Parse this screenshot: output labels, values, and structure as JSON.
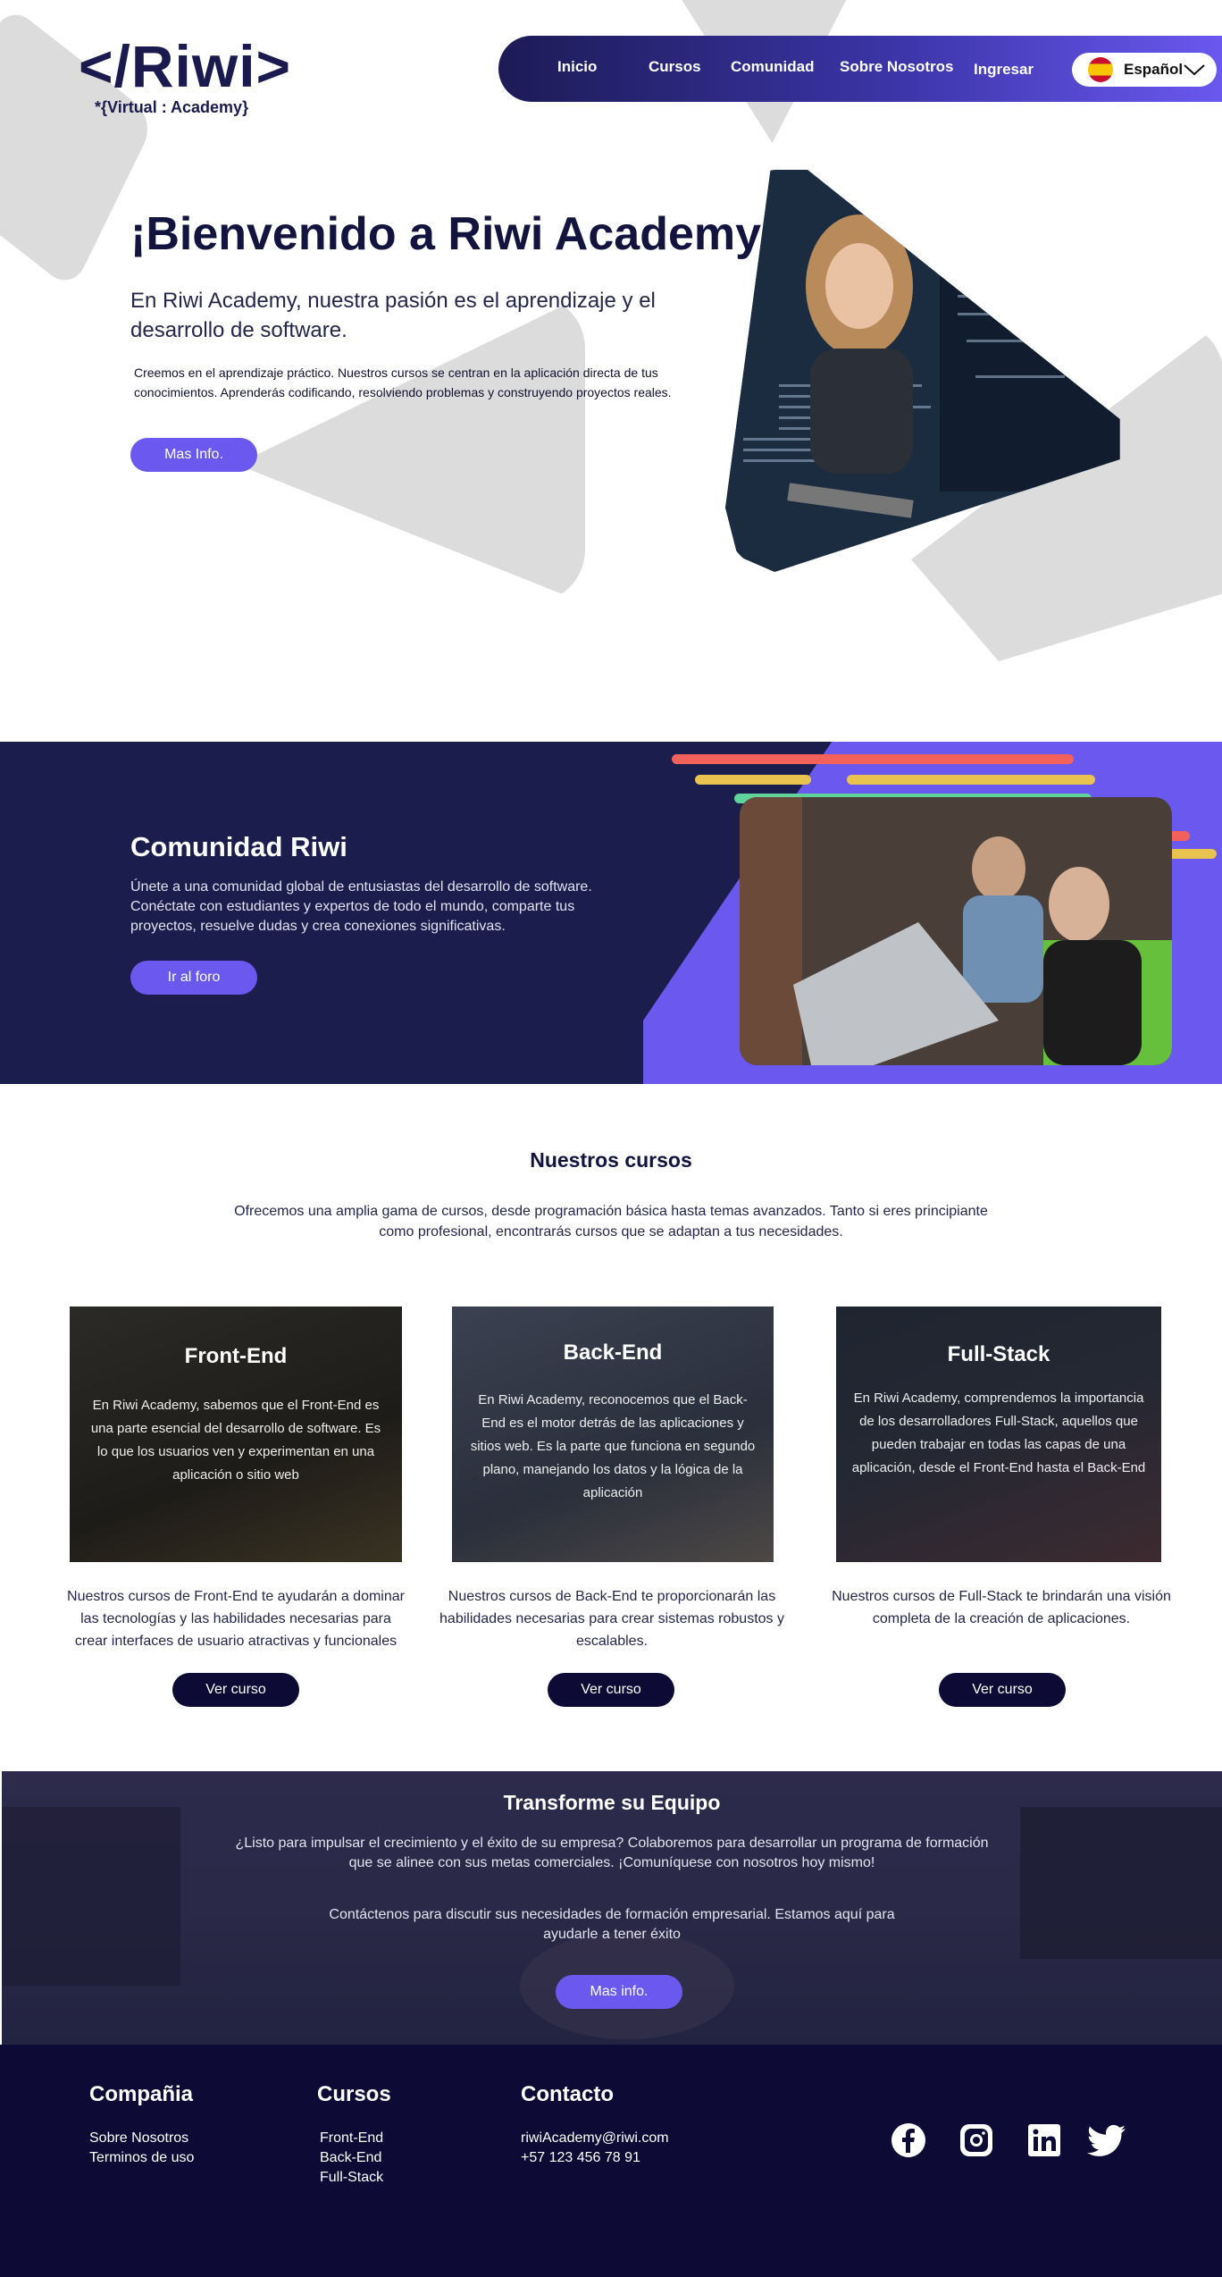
{
  "header": {
    "logo": {
      "main": "</Riwi>",
      "sub": "*{Virtual : Academy}"
    },
    "nav": [
      "Inicio",
      "Cursos",
      "Comunidad",
      "Sobre Nosotros",
      "Ingresar"
    ],
    "language": "Español"
  },
  "hero": {
    "title": "¡Bienvenido a Riwi Academy!",
    "subtitle": "En Riwi Academy, nuestra pasión es el aprendizaje y el desarrollo de software.",
    "text": "Creemos en el aprendizaje práctico. Nuestros cursos se centran en la aplicación directa de tus conocimientos. Aprenderás codificando, resolviendo problemas y construyendo proyectos reales.",
    "button": "Mas Info."
  },
  "community": {
    "title": "Comunidad Riwi",
    "text": "Únete a una comunidad global de entusiastas del desarrollo de software. Conéctate con estudiantes y expertos de todo el mundo, comparte tus proyectos, resuelve dudas y crea conexiones significativas.",
    "button": "Ir al foro"
  },
  "courses": {
    "title": "Nuestros cursos",
    "intro": "Ofrecemos una amplia gama de cursos, desde programación básica hasta temas avanzados. Tanto si eres principiante como profesional, encontrarás cursos que se adaptan a tus necesidades.",
    "items": [
      {
        "title": "Front-End",
        "card_text": "En Riwi Academy, sabemos que el Front-End es una parte esencial del desarrollo de software. Es lo que los usuarios ven y experimentan en una aplicación o sitio web",
        "description": "Nuestros cursos de Front-End te ayudarán a dominar las tecnologías y las habilidades necesarias para crear interfaces de usuario atractivas y funcionales",
        "button": "Ver curso"
      },
      {
        "title": "Back-End",
        "card_text": "En Riwi Academy, reconocemos que el Back-End es el motor detrás de las aplicaciones y sitios web. Es la parte que funciona en segundo plano, manejando los datos y la lógica de la aplicación",
        "description": "Nuestros cursos de Back-End te proporcionarán las habilidades necesarias para crear sistemas robustos y escalables.",
        "button": "Ver curso"
      },
      {
        "title": "Full-Stack",
        "card_text": "En Riwi Academy, comprendemos la importancia de los desarrolladores Full-Stack, aquellos que pueden trabajar en todas las capas de una aplicación, desde el Front-End hasta el Back-End",
        "description": "Nuestros cursos de Full-Stack te brindarán una visión completa de la creación de aplicaciones.",
        "button": "Ver curso"
      }
    ]
  },
  "team": {
    "title": "Transforme su Equipo",
    "text1": "¿Listo para impulsar el crecimiento y el éxito de su empresa? Colaboremos para desarrollar un programa de formación que se alinee con sus metas comerciales. ¡Comuníquese con nosotros hoy mismo!",
    "text2": "Contáctenos para discutir sus necesidades de formación empresarial. Estamos aquí para ayudarle a tener éxito",
    "button": "Mas info."
  },
  "footer": {
    "company": {
      "title": "Compañia",
      "links": [
        "Sobre Nosotros",
        "Terminos de uso"
      ]
    },
    "courses": {
      "title": "Cursos",
      "links": [
        "Front-End",
        "Back-End",
        "Full-Stack"
      ]
    },
    "contact": {
      "title": "Contacto",
      "email": "riwiAcademy@riwi.com",
      "phone": "+57 123 456 78 91"
    },
    "social": [
      "facebook-icon",
      "instagram-icon",
      "linkedin-icon",
      "twitter-icon"
    ]
  },
  "colors": {
    "brand_purple": "#6a58ef",
    "navy": "#1b1d4d",
    "footer_navy": "#0d0a36"
  }
}
